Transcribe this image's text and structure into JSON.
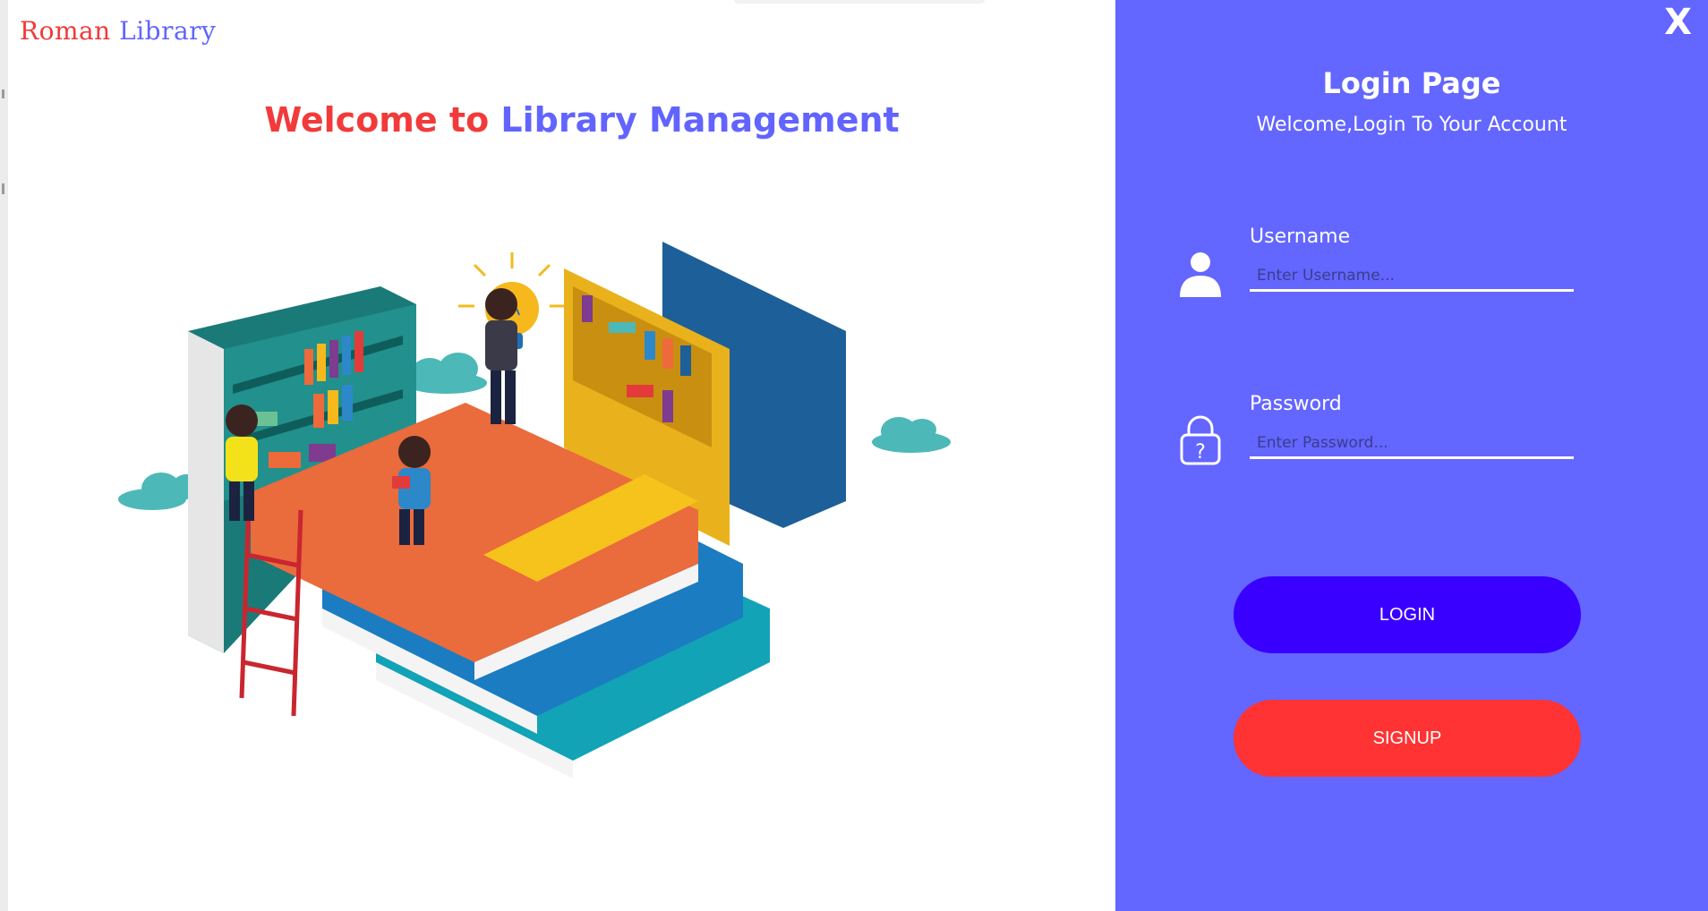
{
  "brand": {
    "word1": "Roman",
    "word2": "Library"
  },
  "welcome": {
    "part1": "Welcome to",
    "part2": "Library Management"
  },
  "login": {
    "close_label": "X",
    "title": "Login Page",
    "subtitle": "Welcome,Login To Your Account",
    "username": {
      "label": "Username",
      "placeholder": "Enter Username...",
      "value": "",
      "icon": "user-icon"
    },
    "password": {
      "label": "Password",
      "placeholder": "Enter Password...",
      "value": "",
      "icon": "lock-question-icon"
    },
    "login_button": "LOGIN",
    "signup_button": "SIGNUP"
  },
  "colors": {
    "panel": "#6366ff",
    "brand_red": "#f03a3a",
    "brand_blue": "#6264ff",
    "login_button": "#3a00ff",
    "signup_button": "#ff3333"
  }
}
